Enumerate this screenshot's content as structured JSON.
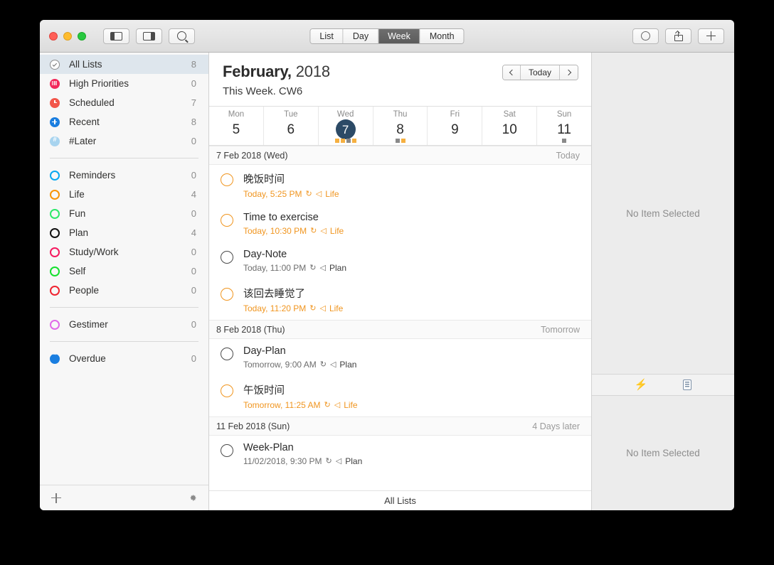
{
  "window": {
    "traffic_lights": [
      "close",
      "minimize",
      "zoom"
    ],
    "toolbar": {
      "sidebar_toggle_left": "sidebar-left-toggle",
      "sidebar_toggle_right": "sidebar-right-toggle",
      "search": "search",
      "segments": [
        {
          "label": "List",
          "active": false
        },
        {
          "label": "Day",
          "active": false
        },
        {
          "label": "Week",
          "active": true
        },
        {
          "label": "Month",
          "active": false
        }
      ],
      "right_buttons": [
        "circle-button",
        "share-button",
        "add-button"
      ]
    }
  },
  "sidebar": {
    "smart_lists": [
      {
        "label": "All Lists",
        "count": "8",
        "color": "#ffffff",
        "icon": "check-circle-icon",
        "selected": true
      },
      {
        "label": "High Priorities",
        "count": "0",
        "color": "#f2295b",
        "icon": "bars-icon",
        "selected": false
      },
      {
        "label": "Scheduled",
        "count": "7",
        "color": "#f2564a",
        "icon": "clock-icon",
        "selected": false
      },
      {
        "label": "Recent",
        "count": "8",
        "color": "#1a7ee0",
        "icon": "plus-circle-icon",
        "selected": false
      },
      {
        "label": "#Later",
        "count": "0",
        "color": "#a8d4ef",
        "icon": "hash-icon",
        "selected": false
      }
    ],
    "user_lists": [
      {
        "label": "Reminders",
        "count": "0",
        "color": "#07a8f0"
      },
      {
        "label": "Life",
        "count": "4",
        "color": "#f89406"
      },
      {
        "label": "Fun",
        "count": "0",
        "color": "#2ee86a"
      },
      {
        "label": "Plan",
        "count": "4",
        "color": "#111111"
      },
      {
        "label": "Study/Work",
        "count": "0",
        "color": "#f5195f"
      },
      {
        "label": "Self",
        "count": "0",
        "color": "#14e02e"
      },
      {
        "label": "People",
        "count": "0",
        "color": "#ef2430"
      }
    ],
    "integrations": [
      {
        "label": "Gestimer",
        "count": "0",
        "color": "#e06ae8"
      }
    ],
    "overdue": [
      {
        "label": "Overdue",
        "count": "0",
        "color": "#1a7ee0",
        "icon": "tilde-icon"
      }
    ],
    "footer": {
      "add": "add-list-button",
      "settings": "settings-gear-button"
    }
  },
  "main": {
    "month": "February,",
    "year": "2018",
    "subtitle": "This Week. CW6",
    "nav": {
      "prev": "previous-week",
      "today_label": "Today",
      "next": "next-week"
    },
    "week": [
      {
        "name": "Mon",
        "num": "5",
        "today": false,
        "dots": []
      },
      {
        "name": "Tue",
        "num": "6",
        "today": false,
        "dots": []
      },
      {
        "name": "Wed",
        "num": "7",
        "today": true,
        "dots": [
          "#f5b041",
          "#f5b041",
          "#8a8a8a",
          "#f5b041"
        ]
      },
      {
        "name": "Thu",
        "num": "8",
        "today": false,
        "dots": [
          "#8a8a8a",
          "#f5b041"
        ]
      },
      {
        "name": "Fri",
        "num": "9",
        "today": false,
        "dots": []
      },
      {
        "name": "Sat",
        "num": "10",
        "today": false,
        "dots": []
      },
      {
        "name": "Sun",
        "num": "11",
        "today": false,
        "dots": [
          "#8a8a8a"
        ]
      }
    ],
    "sections": [
      {
        "date": "7 Feb 2018 (Wed)",
        "relative": "Today",
        "tasks": [
          {
            "title": "晚饭时间",
            "meta": "Today, 5:25 PM",
            "repeat": "↻",
            "sound": "◁",
            "list": "Life",
            "accent": "orange"
          },
          {
            "title": "Time to exercise",
            "meta": "Today, 10:30 PM",
            "repeat": "↻",
            "sound": "◁",
            "list": "Life",
            "accent": "orange"
          },
          {
            "title": "Day-Note",
            "meta": "Today, 11:00 PM",
            "repeat": "↻",
            "sound": "◁",
            "list": "Plan",
            "accent": "dark"
          },
          {
            "title": "该回去睡觉了",
            "meta": "Today, 11:20 PM",
            "repeat": "↻",
            "sound": "◁",
            "list": "Life",
            "accent": "orange"
          }
        ]
      },
      {
        "date": "8 Feb 2018 (Thu)",
        "relative": "Tomorrow",
        "tasks": [
          {
            "title": "Day-Plan",
            "meta": "Tomorrow, 9:00 AM",
            "repeat": "↻",
            "sound": "◁",
            "list": "Plan",
            "accent": "dark"
          },
          {
            "title": "午饭时间",
            "meta": "Tomorrow, 11:25 AM",
            "repeat": "↻",
            "sound": "◁",
            "list": "Life",
            "accent": "orange"
          }
        ]
      },
      {
        "date": "11 Feb 2018 (Sun)",
        "relative": "4 Days later",
        "tasks": [
          {
            "title": "Week-Plan",
            "meta": "11/02/2018, 9:30 PM",
            "repeat": "↻",
            "sound": "◁",
            "list": "Plan",
            "accent": "dark"
          }
        ]
      }
    ],
    "footer_label": "All Lists"
  },
  "detail": {
    "top_placeholder": "No Item Selected",
    "tabs": [
      "bolt-icon",
      "notes-icon"
    ],
    "bottom_placeholder": "No Item Selected"
  }
}
